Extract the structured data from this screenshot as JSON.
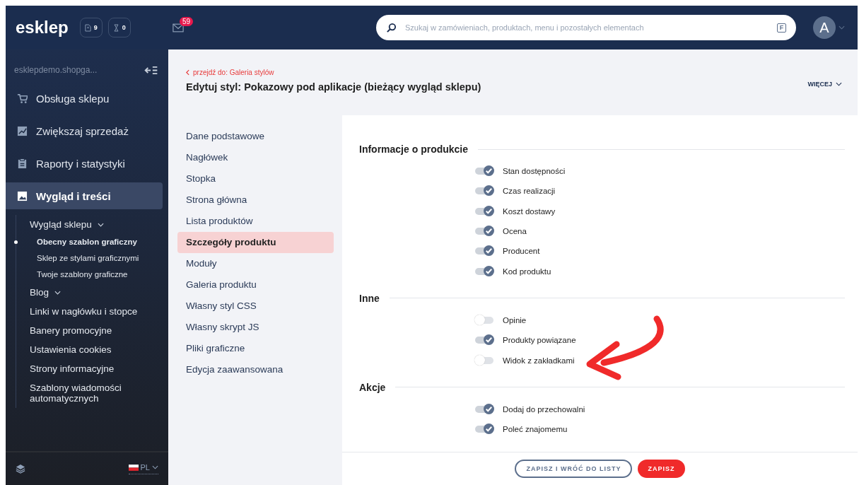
{
  "topbar": {
    "logo": "esklep",
    "counters": [
      {
        "kind": "document",
        "value": "9"
      },
      {
        "kind": "hourglass",
        "value": "0"
      }
    ],
    "mail_badge": "59",
    "search": {
      "placeholder": "Szukaj w zamówieniach, produktach, menu i pozostałych elementach",
      "shortcut": "F"
    },
    "avatar": "A"
  },
  "sidebar": {
    "shop": "esklepdemo.shopga...",
    "items": [
      {
        "kind": "cart",
        "label": "Obsługa sklepu",
        "selected": false
      },
      {
        "kind": "chart",
        "label": "Zwiększaj sprzedaż",
        "selected": false
      },
      {
        "kind": "clipboard",
        "label": "Raporty i statystyki",
        "selected": false
      },
      {
        "kind": "image",
        "label": "Wygląd i treści",
        "selected": true
      }
    ],
    "subitems": [
      {
        "label": "Wygląd sklepu",
        "expandable": true,
        "children": [
          {
            "label": "Obecny szablon graficzny",
            "selected": true
          },
          {
            "label": "Sklep ze stylami graficznymi",
            "selected": false
          },
          {
            "label": "Twoje szablony graficzne",
            "selected": false
          }
        ]
      },
      {
        "label": "Blog",
        "expandable": true
      },
      {
        "label": "Linki w nagłówku i stopce",
        "expandable": false
      },
      {
        "label": "Banery promocyjne",
        "expandable": false
      },
      {
        "label": "Ustawienia cookies",
        "expandable": false
      },
      {
        "label": "Strony informacyjne",
        "expandable": false
      },
      {
        "label": "Szablony wiadomości automatycznych",
        "expandable": false
      }
    ],
    "language": "PL"
  },
  "header": {
    "back_link": "przejdź do: Galeria stylów",
    "title": "Edytuj styl: Pokazowy pod aplikacje (bieżący wygląd sklepu)",
    "more": "WIĘCEJ"
  },
  "sections_nav": [
    {
      "label": "Dane podstawowe",
      "selected": false
    },
    {
      "label": "Nagłówek",
      "selected": false
    },
    {
      "label": "Stopka",
      "selected": false
    },
    {
      "label": "Strona główna",
      "selected": false
    },
    {
      "label": "Lista produktów",
      "selected": false
    },
    {
      "label": "Szczegóły produktu",
      "selected": true
    },
    {
      "label": "Moduły",
      "selected": false
    },
    {
      "label": "Galeria produktu",
      "selected": false
    },
    {
      "label": "Własny styl CSS",
      "selected": false
    },
    {
      "label": "Własny skrypt JS",
      "selected": false
    },
    {
      "label": "Pliki graficzne",
      "selected": false
    },
    {
      "label": "Edycja zaawansowana",
      "selected": false
    }
  ],
  "groups": [
    {
      "title": "Informacje o produkcie",
      "options": [
        {
          "label": "Stan dostępności",
          "on": true
        },
        {
          "label": "Czas realizacji",
          "on": true
        },
        {
          "label": "Koszt dostawy",
          "on": true
        },
        {
          "label": "Ocena",
          "on": true
        },
        {
          "label": "Producent",
          "on": true
        },
        {
          "label": "Kod produktu",
          "on": true
        }
      ]
    },
    {
      "title": "Inne",
      "options": [
        {
          "label": "Opinie",
          "on": false
        },
        {
          "label": "Produkty powiązane",
          "on": true
        },
        {
          "label": "Widok z zakładkami",
          "on": false
        }
      ]
    },
    {
      "title": "Akcje",
      "options": [
        {
          "label": "Dodaj do przechowalni",
          "on": true
        },
        {
          "label": "Poleć znajomemu",
          "on": true
        }
      ]
    }
  ],
  "footer": {
    "secondary_button": "ZAPISZ I WRÓĆ DO LISTY",
    "primary_button": "ZAPISZ"
  }
}
